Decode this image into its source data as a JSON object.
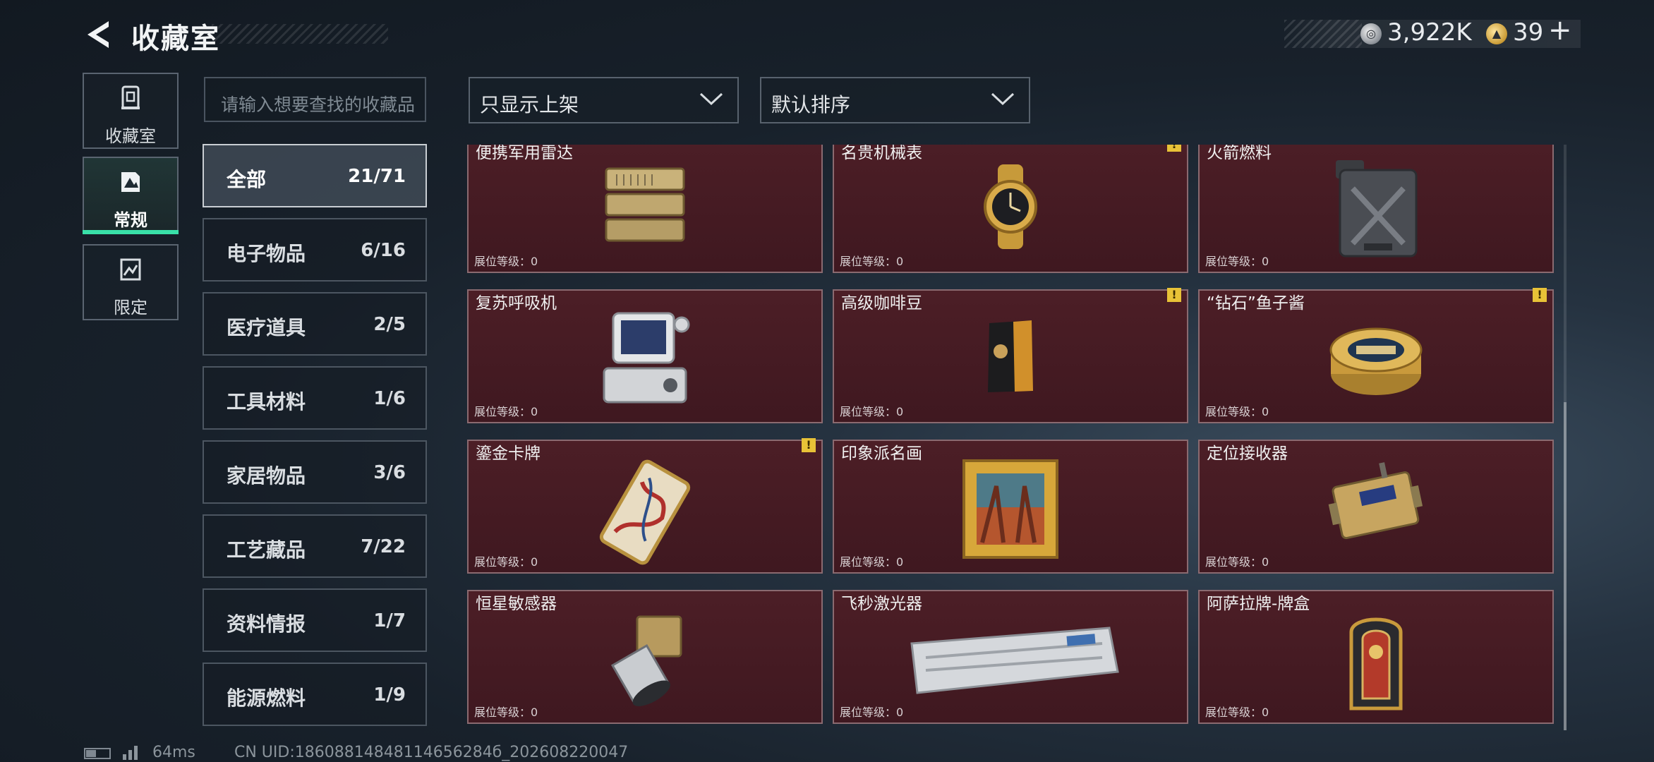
{
  "header": {
    "title": "收藏室",
    "currency_silver": "3,922K",
    "currency_gold": "39",
    "plus_label": "+"
  },
  "side_tabs": [
    {
      "label": "收藏室",
      "icon": "collection-icon"
    },
    {
      "label": "常规",
      "icon": "regular-icon",
      "selected": true
    },
    {
      "label": "限定",
      "icon": "limited-icon"
    }
  ],
  "search": {
    "placeholder": "请输入想要查找的收藏品"
  },
  "filters": {
    "display_filter": "只显示上架",
    "sort": "默认排序"
  },
  "categories": [
    {
      "name": "全部",
      "count": "21/71",
      "active": true
    },
    {
      "name": "电子物品",
      "count": "6/16"
    },
    {
      "name": "医疗道具",
      "count": "2/5"
    },
    {
      "name": "工具材料",
      "count": "1/6"
    },
    {
      "name": "家居物品",
      "count": "3/6"
    },
    {
      "name": "工艺藏品",
      "count": "7/22"
    },
    {
      "name": "资料情报",
      "count": "1/7"
    },
    {
      "name": "能源燃料",
      "count": "1/9"
    }
  ],
  "items": [
    {
      "name": "便携军用雷达",
      "level": "展位等级：0",
      "warn": false,
      "icon": "radar-icon"
    },
    {
      "name": "名贵机械表",
      "level": "展位等级：0",
      "warn": true,
      "icon": "watch-icon"
    },
    {
      "name": "火箭燃料",
      "level": "展位等级：0",
      "warn": false,
      "icon": "jerrycan-icon"
    },
    {
      "name": "复苏呼吸机",
      "level": "展位等级：0",
      "warn": false,
      "icon": "ventilator-icon"
    },
    {
      "name": "高级咖啡豆",
      "level": "展位等级：0",
      "warn": true,
      "icon": "coffee-bag-icon"
    },
    {
      "name": "“钻石”鱼子酱",
      "level": "展位等级：0",
      "warn": true,
      "icon": "caviar-tin-icon"
    },
    {
      "name": "鎏金卡牌",
      "level": "展位等级：0",
      "warn": true,
      "icon": "gilded-card-icon"
    },
    {
      "name": "印象派名画",
      "level": "展位等级：0",
      "warn": false,
      "icon": "painting-icon"
    },
    {
      "name": "定位接收器",
      "level": "展位等级：0",
      "warn": false,
      "icon": "receiver-icon"
    },
    {
      "name": "恒星敏感器",
      "level": "展位等级：0",
      "warn": false,
      "icon": "star-sensor-icon"
    },
    {
      "name": "飞秒激光器",
      "level": "展位等级：0",
      "warn": false,
      "icon": "laser-icon"
    },
    {
      "name": "阿萨拉牌-牌盒",
      "level": "展位等级：0",
      "warn": false,
      "icon": "card-box-icon"
    }
  ],
  "footer": {
    "ping": "64ms",
    "uid": "CN UID:18608814848114656284б_202608220047"
  }
}
